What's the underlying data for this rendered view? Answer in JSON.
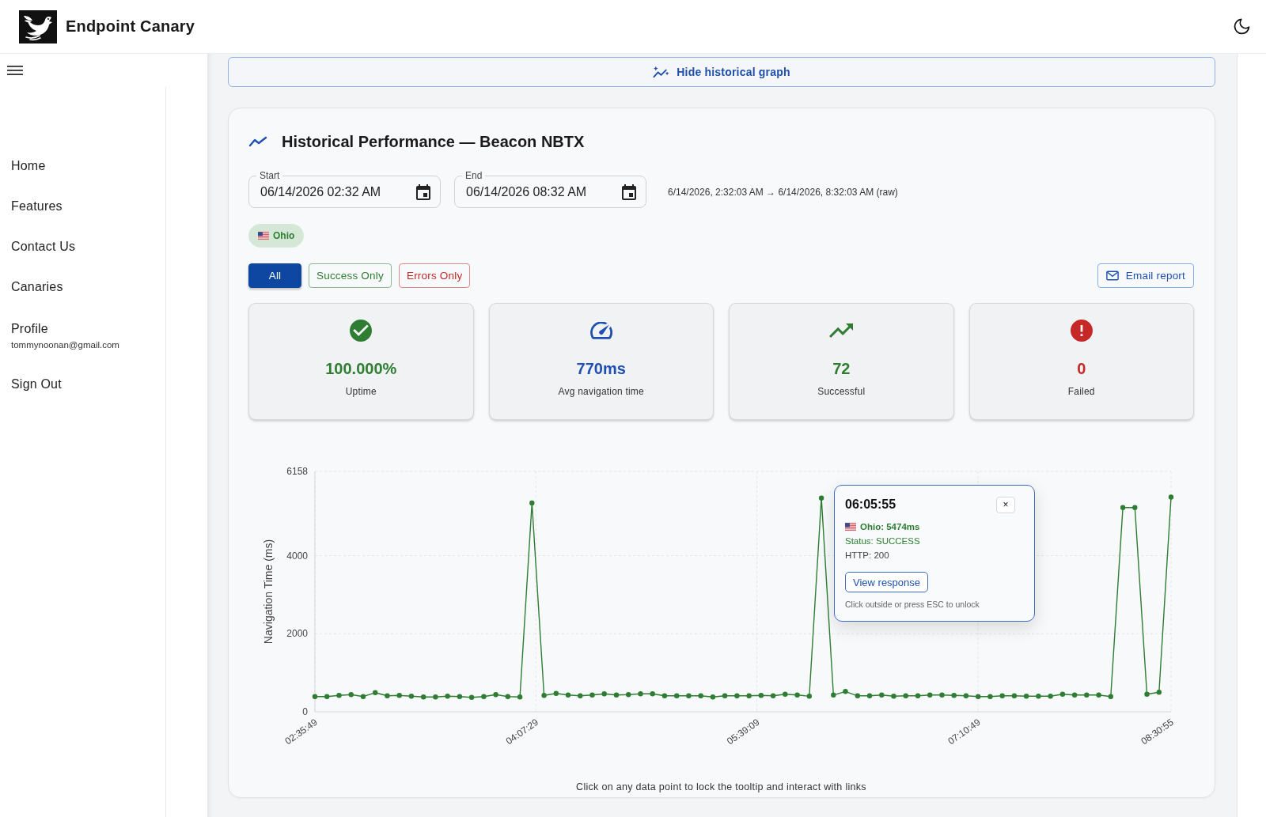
{
  "header": {
    "title": "Endpoint Canary"
  },
  "sidebar": {
    "items": [
      {
        "label": "Home"
      },
      {
        "label": "Features"
      },
      {
        "label": "Contact Us"
      },
      {
        "label": "Canaries"
      },
      {
        "label": "Profile",
        "secondary": "tommynoonan@gmail.com"
      },
      {
        "label": "Sign Out"
      }
    ]
  },
  "graph_toggle": {
    "label": "Hide historical graph"
  },
  "card": {
    "title": "Historical Performance — Beacon NBTX",
    "date_fields": [
      {
        "label": "Start",
        "value": "06/14/2026 02:32 AM"
      },
      {
        "label": "End",
        "value": "06/14/2026 08:32 AM"
      }
    ],
    "range_text": "6/14/2026, 2:32:03 AM → 6/14/2026, 8:32:03 AM (raw)",
    "regions": [
      {
        "label": "Ohio",
        "selected": true
      }
    ],
    "filters": [
      {
        "label": "All",
        "selected": true,
        "color": "#0d47a1"
      },
      {
        "label": "Success Only",
        "selected": false,
        "color": "#2e7d32"
      },
      {
        "label": "Errors Only",
        "selected": false,
        "color": "#c62828"
      }
    ],
    "email_button": {
      "label": "Email report"
    },
    "stats": [
      {
        "value": "100.000%",
        "label": "Uptime",
        "color": "#2e7d32"
      },
      {
        "value": "770ms",
        "label": "Avg navigation time",
        "color": "#1e4fb3"
      },
      {
        "value": "72",
        "label": "Successful",
        "color": "#2e7d32"
      },
      {
        "value": "0",
        "label": "Failed",
        "color": "#c62828"
      }
    ],
    "chart": {
      "chart_data": {
        "type": "line",
        "ylabel": "Navigation Time (ms)",
        "color": "#2e7d32",
        "marker": "circle",
        "grid": true,
        "xlim": [
          2.5969,
          8.5153
        ],
        "ylim": [
          0,
          6158
        ],
        "yticks": [
          0,
          2000,
          4000,
          6158
        ],
        "xticks": [
          {
            "value": 2.5969,
            "label": "02:35:49"
          },
          {
            "value": 4.1247,
            "label": "04:07:29"
          },
          {
            "value": 5.6525,
            "label": "05:39:09"
          },
          {
            "value": 7.1803,
            "label": "07:10:49"
          },
          {
            "value": 8.5153,
            "label": "08:30:55"
          }
        ],
        "x": [
          2.5969,
          2.6803,
          2.7636,
          2.847,
          2.9304,
          3.0137,
          3.0971,
          3.1804,
          3.2638,
          3.3472,
          3.4305,
          3.5139,
          3.5972,
          3.6806,
          3.764,
          3.8473,
          3.9307,
          4.014,
          4.0974,
          4.1808,
          4.2641,
          4.3475,
          4.4308,
          4.5142,
          4.5975,
          4.6809,
          4.7643,
          4.8476,
          4.931,
          5.0143,
          5.0977,
          5.1811,
          5.2644,
          5.3478,
          5.4311,
          5.5145,
          5.5978,
          5.6812,
          5.7646,
          5.8479,
          5.9313,
          6.0146,
          6.098,
          6.1814,
          6.2647,
          6.3481,
          6.4314,
          6.5148,
          6.5982,
          6.6815,
          6.7649,
          6.8482,
          6.9316,
          7.0149,
          7.0983,
          7.1817,
          7.265,
          7.3484,
          7.4317,
          7.5151,
          7.5985,
          7.6818,
          7.7652,
          7.8485,
          7.9319,
          8.0152,
          8.0986,
          8.182,
          8.2653,
          8.3487,
          8.432,
          8.5153
        ],
        "values": [
          390,
          390,
          420,
          440,
          390,
          490,
          410,
          420,
          400,
          380,
          380,
          400,
          390,
          370,
          390,
          440,
          390,
          380,
          5350,
          420,
          470,
          430,
          410,
          430,
          460,
          430,
          440,
          460,
          460,
          410,
          410,
          410,
          410,
          380,
          410,
          410,
          410,
          420,
          410,
          450,
          430,
          400,
          5474,
          430,
          520,
          410,
          410,
          430,
          400,
          410,
          410,
          430,
          430,
          420,
          410,
          390,
          390,
          410,
          410,
          400,
          400,
          400,
          450,
          430,
          430,
          430,
          390,
          5230,
          5230,
          450,
          500,
          5500
        ]
      },
      "tooltip": {
        "time": "06:05:55",
        "close": "×",
        "series": "Ohio: 5474ms",
        "status": "Status: SUCCESS",
        "http": "HTTP: 200",
        "action": "View response",
        "hint": "Click outside or press ESC to unlock"
      }
    },
    "hint": "Click on any data point to lock the tooltip and interact with links"
  }
}
